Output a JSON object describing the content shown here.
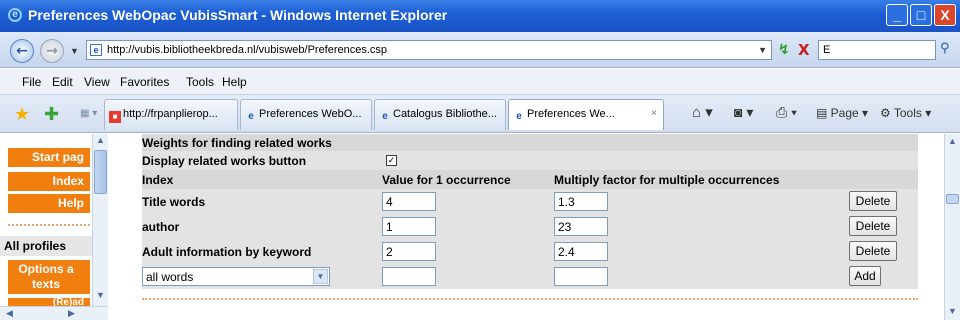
{
  "window": {
    "title": "Preferences WebOpac VubisSmart - Windows Internet Explorer",
    "app_icon": "e",
    "minimize": "_",
    "maximize": "□",
    "close": "X"
  },
  "address_bar": {
    "back": "←",
    "forward": "→",
    "url": "http://vubis.bibliotheekbreda.nl/vubisweb/Preferences.csp",
    "favicon": "e",
    "refresh": "↯",
    "stop": "X",
    "search_value": "E",
    "search_icon": "⚲"
  },
  "menu": {
    "file": "File",
    "edit": "Edit",
    "view": "View",
    "favorites": "Favorites",
    "tools": "Tools",
    "help": "Help"
  },
  "tabs": [
    {
      "label": "http://frpanplierop...",
      "icon": "red-favicon"
    },
    {
      "label": "Preferences WebO...",
      "icon": "ie-icon"
    },
    {
      "label": "Catalogus Bibliothe...",
      "icon": "ie-icon"
    },
    {
      "label": "Preferences We...",
      "icon": "ie-icon",
      "active": true,
      "close": "×"
    }
  ],
  "toolbar": {
    "page": "Page",
    "tools": "Tools"
  },
  "sidebar": {
    "start": "Start pag",
    "index": "Index",
    "help": "Help",
    "all_profiles": "All profiles",
    "options_line1": "Options a",
    "options_line2": "texts",
    "cut_label": "(Re)ad"
  },
  "content": {
    "section_title": "Weights for finding related works",
    "display_button_label": "Display related works button",
    "display_button_checked": true,
    "headers": {
      "index": "Index",
      "value": "Value for 1 occurrence",
      "factor": "Multiply factor for multiple occurrences"
    },
    "rows": [
      {
        "index": "Title words",
        "value": "4",
        "factor": "1.3",
        "action": "Delete"
      },
      {
        "index": "author",
        "value": "1",
        "factor": "23",
        "action": "Delete"
      },
      {
        "index": "Adult information by keyword",
        "value": "2",
        "factor": "2.4",
        "action": "Delete"
      }
    ],
    "new_row": {
      "select_value": "all words",
      "value": "",
      "factor": "",
      "action": "Add"
    }
  },
  "colors": {
    "accent_orange": "#f07f10",
    "titlebar_blue": "#1d5fd6"
  }
}
